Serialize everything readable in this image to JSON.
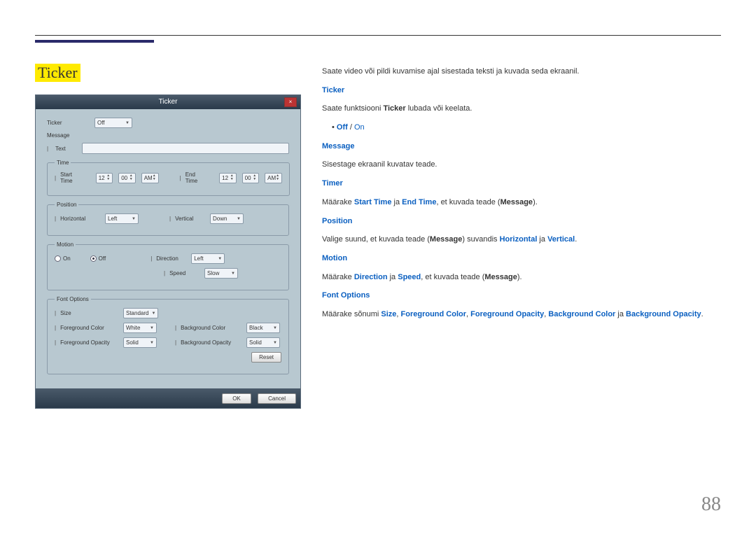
{
  "pageNumber": "88",
  "title": "Ticker",
  "dlg": {
    "title": "Ticker",
    "close": "×",
    "ticker_lbl": "Ticker",
    "ticker_val": "Off",
    "message_lbl": "Message",
    "text_lbl": "Text",
    "time_leg": "Time",
    "start_lbl": "Start Time",
    "end_lbl": "End Time",
    "h1": "12",
    "m1": "00",
    "ap1": "AM",
    "h2": "12",
    "m2": "00",
    "ap2": "AM",
    "pos_leg": "Position",
    "horiz_lbl": "Horizontal",
    "horiz_val": "Left",
    "vert_lbl": "Vertical",
    "vert_val": "Down",
    "motion_leg": "Motion",
    "on_lbl": "On",
    "off_lbl": "Off",
    "dir_lbl": "Direction",
    "dir_val": "Left",
    "spd_lbl": "Speed",
    "spd_val": "Slow",
    "font_leg": "Font Options",
    "size_lbl": "Size",
    "size_val": "Standard",
    "fgc_lbl": "Foreground Color",
    "fgc_val": "White",
    "bgc_lbl": "Background Color",
    "bgc_val": "Black",
    "fgo_lbl": "Foreground Opacity",
    "fgo_val": "Solid",
    "bgo_lbl": "Background Opacity",
    "bgo_val": "Solid",
    "reset": "Reset",
    "ok": "OK",
    "cancel": "Cancel"
  },
  "doc": {
    "intro": "Saate video või pildi kuvamise ajal sisestada teksti ja kuvada seda ekraanil.",
    "h_ticker": "Ticker",
    "ticker_txt_a": "Saate funktsiooni ",
    "ticker_txt_b": "Ticker",
    "ticker_txt_c": " lubada või keelata.",
    "bullet": "•   ",
    "off": "Off",
    "slash": " / ",
    "on": "On",
    "h_msg": "Message",
    "msg_txt": "Sisestage ekraanil kuvatav teade.",
    "h_timer": "Timer",
    "timer_a": "Määrake ",
    "timer_b": "Start Time",
    "timer_c": " ja ",
    "timer_d": "End Time",
    "timer_e": ", et kuvada teade (",
    "timer_f": "Message",
    "timer_g": ").",
    "h_pos": "Position",
    "pos_a": "Valige suund, et kuvada teade (",
    "pos_b": "Message",
    "pos_c": ") suvandis ",
    "pos_d": "Horizontal",
    "pos_e": " ja ",
    "pos_f": "Vertical",
    "pos_g": ".",
    "h_motion": "Motion",
    "mot_a": "Määrake ",
    "mot_b": "Direction",
    "mot_c": " ja ",
    "mot_d": "Speed",
    "mot_e": ", et kuvada teade (",
    "mot_f": "Message",
    "mot_g": ").",
    "h_font": "Font Options",
    "font_a": "Määrake sõnumi ",
    "font_b": "Size",
    "font_c": ", ",
    "font_d": "Foreground Color",
    "font_e": ", ",
    "font_f": "Foreground Opacity",
    "font_g": ", ",
    "font_h": "Background Color",
    "font_i": " ja ",
    "font_j": "Background Opacity",
    "font_k": "."
  }
}
